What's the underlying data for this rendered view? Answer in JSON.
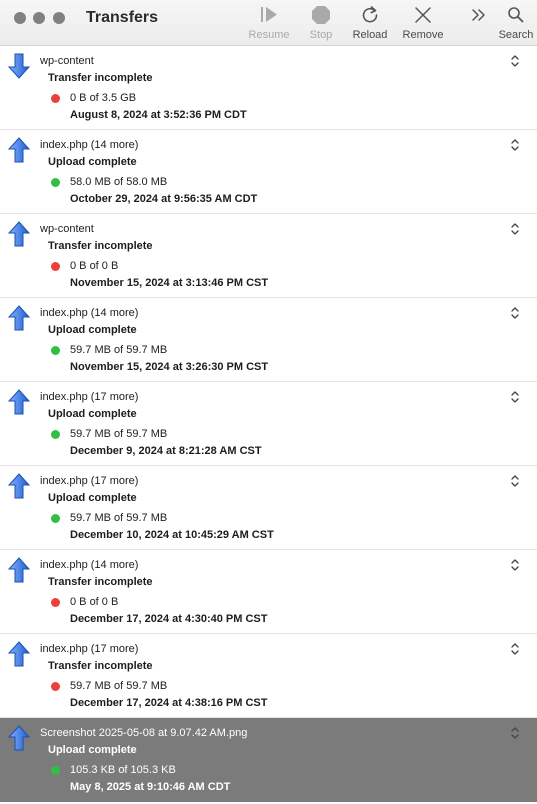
{
  "window": {
    "title": "Transfers"
  },
  "toolbar": {
    "resume_label": "Resume",
    "stop_label": "Stop",
    "reload_label": "Reload",
    "remove_label": "Remove",
    "search_label": "Search",
    "more_icon": "chevron-double-right-icon"
  },
  "colors": {
    "red_status": "#e9403a",
    "green_status": "#2fbf45",
    "selection": "#7b7b7b",
    "arrow_blue": "#2f6fd8"
  },
  "transfers": [
    {
      "direction": "down",
      "name": "wp-content",
      "status": "Transfer incomplete",
      "state": "red",
      "size": "0 B of 3.5 GB",
      "date": "August 8, 2024 at 3:52:36 PM CDT"
    },
    {
      "direction": "up",
      "name": "index.php (14 more)",
      "status": "Upload complete",
      "state": "green",
      "size": "58.0 MB of 58.0 MB",
      "date": "October 29, 2024 at 9:56:35 AM CDT"
    },
    {
      "direction": "up",
      "name": "wp-content",
      "status": "Transfer incomplete",
      "state": "red",
      "size": "0 B of 0 B",
      "date": "November 15, 2024 at 3:13:46 PM CST"
    },
    {
      "direction": "up",
      "name": "index.php (14 more)",
      "status": "Upload complete",
      "state": "green",
      "size": "59.7 MB of 59.7 MB",
      "date": "November 15, 2024 at 3:26:30 PM CST"
    },
    {
      "direction": "up",
      "name": "index.php (17 more)",
      "status": "Upload complete",
      "state": "green",
      "size": "59.7 MB of 59.7 MB",
      "date": "December 9, 2024 at 8:21:28 AM CST"
    },
    {
      "direction": "up",
      "name": "index.php (17 more)",
      "status": "Upload complete",
      "state": "green",
      "size": "59.7 MB of 59.7 MB",
      "date": "December 10, 2024 at 10:45:29 AM CST"
    },
    {
      "direction": "up",
      "name": "index.php (14 more)",
      "status": "Transfer incomplete",
      "state": "red",
      "size": "0 B of 0 B",
      "date": "December 17, 2024 at 4:30:40 PM CST"
    },
    {
      "direction": "up",
      "name": "index.php (17 more)",
      "status": "Transfer incomplete",
      "state": "red",
      "size": "59.7 MB of 59.7 MB",
      "date": "December 17, 2024 at 4:38:16 PM CST"
    },
    {
      "direction": "up",
      "name": "Screenshot 2025-05-08 at 9.07.42 AM.png",
      "status": "Upload complete",
      "state": "green",
      "size": "105.3 KB of 105.3 KB",
      "date": "May 8, 2025 at 9:10:46 AM CDT",
      "selected": true
    }
  ]
}
